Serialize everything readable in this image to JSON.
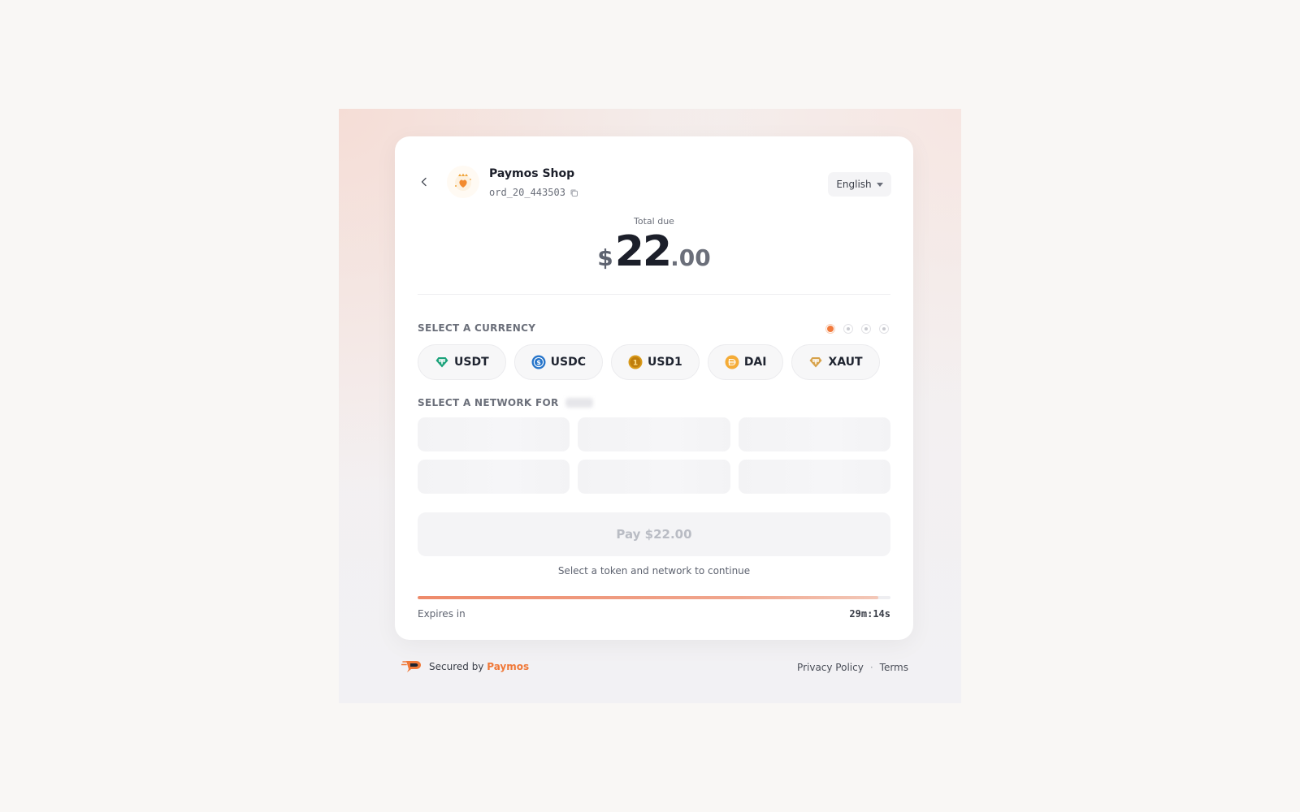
{
  "header": {
    "shop_name": "Paymos Shop",
    "order_id": "ord_20_443503",
    "language": "English"
  },
  "total": {
    "label": "Total due",
    "currency_symbol": "$",
    "integer": "22",
    "decimal": ".00"
  },
  "currency_section": {
    "label": "SELECT A CURRENCY",
    "pagination": {
      "count": 4,
      "active": 1
    },
    "tokens": [
      {
        "symbol": "USDT",
        "icon": "usdt-icon",
        "color": "#1ba27a"
      },
      {
        "symbol": "USDC",
        "icon": "usdc-icon",
        "color": "#2775ca"
      },
      {
        "symbol": "USD1",
        "icon": "usd1-icon",
        "color": "#d99a1a"
      },
      {
        "symbol": "DAI",
        "icon": "dai-icon",
        "color": "#f5ac37"
      },
      {
        "symbol": "XAUT",
        "icon": "xaut-icon",
        "color": "#d7a24a"
      }
    ]
  },
  "network_section": {
    "label": "SELECT A NETWORK FOR",
    "placeholder_count": 6
  },
  "pay_button": {
    "label": "Pay $22.00"
  },
  "hint": "Select a token and network to continue",
  "expiry": {
    "label": "Expires in",
    "countdown": "29m:14s",
    "progress_percent": 97.5
  },
  "footer": {
    "secured_by": "Secured by",
    "brand": "Paymos",
    "privacy": "Privacy Policy",
    "separator": "·",
    "terms": "Terms"
  },
  "colors": {
    "accent": "#f27a3c",
    "background": "#f9f7f5",
    "card": "#ffffff"
  }
}
